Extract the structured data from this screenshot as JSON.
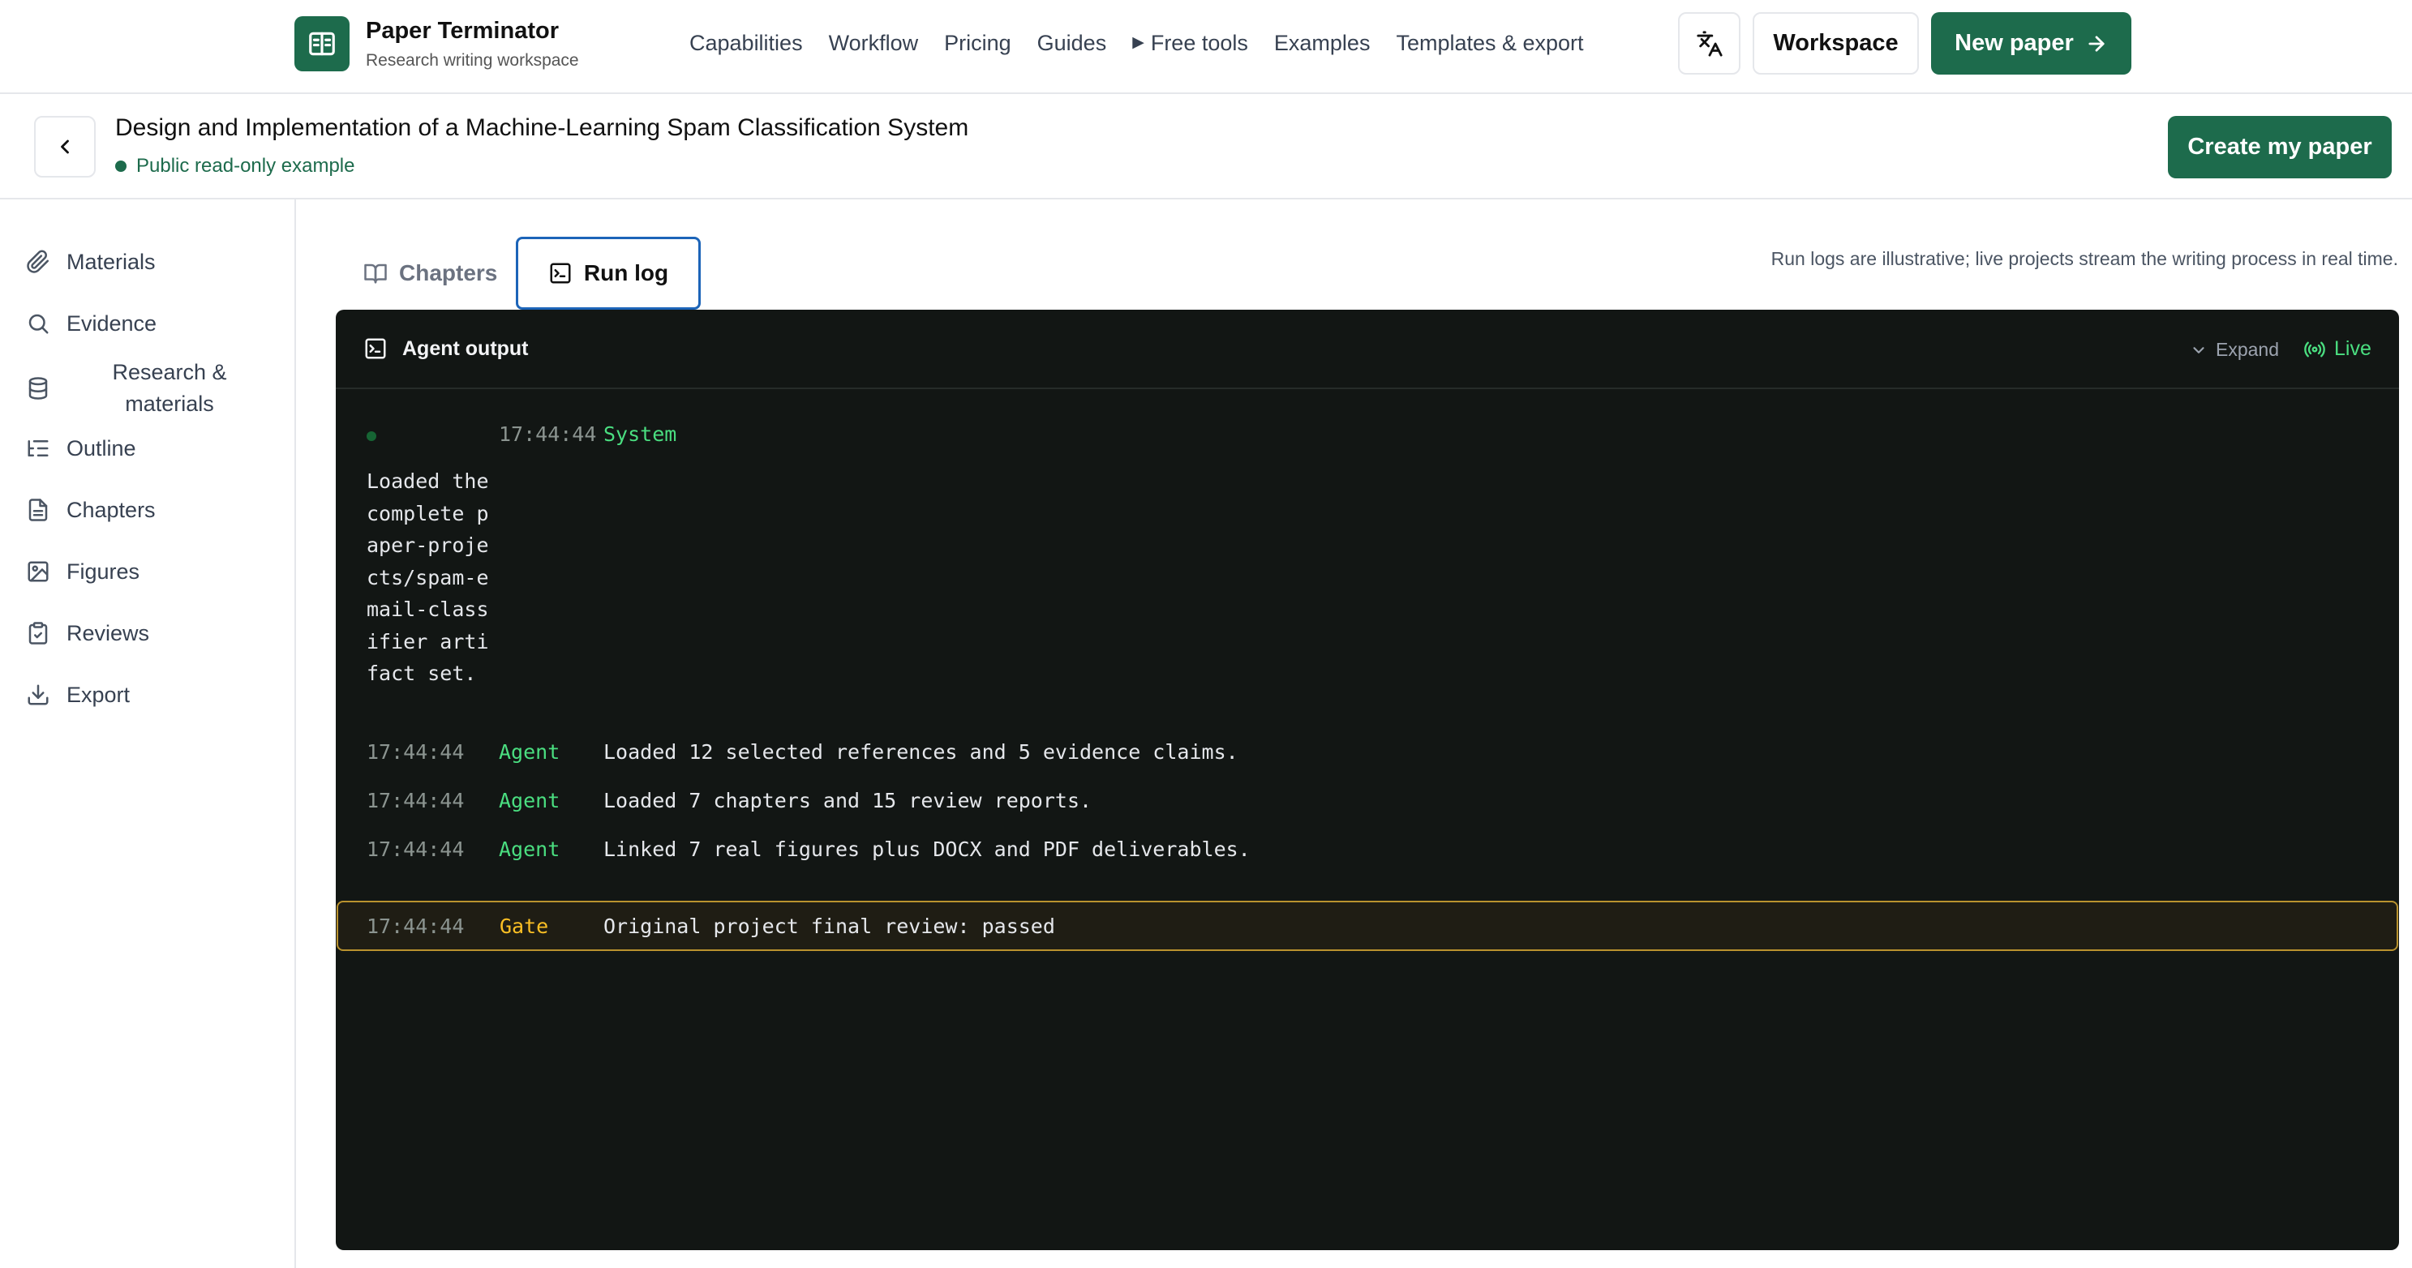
{
  "brand": {
    "name": "Paper Terminator",
    "tagline": "Research writing workspace"
  },
  "nav": {
    "links": [
      "Capabilities",
      "Workflow",
      "Pricing",
      "Guides",
      "Free tools",
      "Examples",
      "Templates & export"
    ],
    "workspace_label": "Workspace",
    "new_paper_label": "New paper"
  },
  "header": {
    "title": "Design and Implementation of a Machine-Learning Spam Classification System",
    "status": "Public read-only example",
    "create_label": "Create my paper"
  },
  "sidebar": {
    "items": [
      {
        "label": "Materials",
        "icon": "paperclip-icon"
      },
      {
        "label": "Evidence",
        "icon": "search-icon"
      },
      {
        "label": "Research & materials",
        "icon": "database-icon"
      },
      {
        "label": "Outline",
        "icon": "list-tree-icon"
      },
      {
        "label": "Chapters",
        "icon": "file-text-icon"
      },
      {
        "label": "Figures",
        "icon": "image-icon"
      },
      {
        "label": "Reviews",
        "icon": "clipboard-check-icon"
      },
      {
        "label": "Export",
        "icon": "download-icon"
      }
    ]
  },
  "tabs": {
    "chapters": "Chapters",
    "run_log": "Run log",
    "active": "Run log"
  },
  "note": "Run logs are illustrative; live projects stream the writing process in real time.",
  "terminal": {
    "title": "Agent output",
    "expand_label": "Expand",
    "live_label": "Live",
    "entries": [
      {
        "time": "17:44:44",
        "source": "System",
        "message": "Loaded the complete paper-projects/spam-email-classifier artifact set."
      },
      {
        "time": "17:44:44",
        "source": "Agent",
        "message": "Loaded 12 selected references and 5 evidence claims."
      },
      {
        "time": "17:44:44",
        "source": "Agent",
        "message": "Loaded 7 chapters and 15 review reports."
      },
      {
        "time": "17:44:44",
        "source": "Agent",
        "message": "Linked 7 real figures plus DOCX and PDF deliverables."
      },
      {
        "time": "17:44:44",
        "source": "Gate",
        "message": "Original project final review: passed"
      }
    ]
  },
  "colors": {
    "brand_green": "#1d6b4c",
    "terminal_bg": "#121614",
    "agent_green": "#4ade80",
    "gate_amber": "#fbbf24",
    "tab_focus_blue": "#1c64b8"
  }
}
